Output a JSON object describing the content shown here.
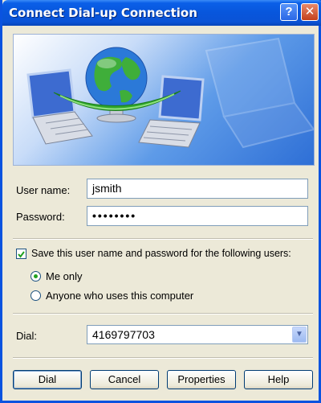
{
  "window": {
    "title": "Connect Dial-up Connection"
  },
  "titlebar": {
    "help_glyph": "?",
    "close_glyph": "✕"
  },
  "form": {
    "username_label": "User name:",
    "username_value": "jsmith",
    "password_label": "Password:",
    "password_value": "••••••••",
    "save_label": "Save this user name and password for the following users:",
    "save_checked": true,
    "me_only_label": "Me only",
    "anyone_label": "Anyone who uses this computer",
    "dial_label": "Dial:",
    "dial_value": "4169797703"
  },
  "buttons": {
    "dial": "Dial",
    "cancel": "Cancel",
    "properties": "Properties",
    "help": "Help"
  },
  "colors": {
    "titlebar": "#0856dc",
    "accent_green": "#21a121"
  },
  "icons": [
    "help-icon",
    "close-icon",
    "globe-icon",
    "laptop-icon",
    "checkmark-icon",
    "chevron-down-icon"
  ]
}
